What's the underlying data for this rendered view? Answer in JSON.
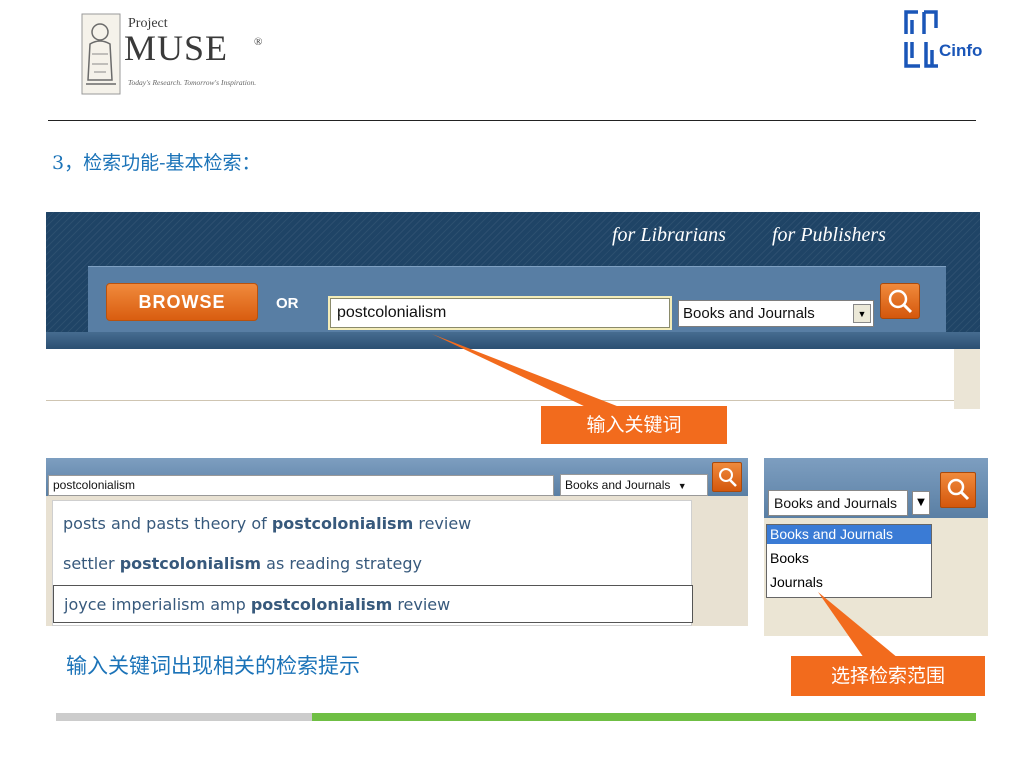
{
  "header": {
    "logo": {
      "project": "Project",
      "muse": "MUSE",
      "registered": "®",
      "tagline": "Today's Research. Tomorrow's Inspiration."
    },
    "cinfo_label": "Cinfo",
    "heading": "3，检索功能-基本检索："
  },
  "banner": {
    "links": [
      "for Librarians",
      "for Publishers"
    ],
    "browse_label": "BROWSE",
    "or_label": "OR",
    "search_value": "postcolonialism",
    "scope_value": "Books and Journals"
  },
  "callouts": {
    "keyword": "输入关键词",
    "scope": "选择检索范围"
  },
  "suggest_panel": {
    "search_value": "postcolonialism",
    "scope_value": "Books and Journals",
    "suggestions": [
      {
        "pre": "posts and pasts theory of ",
        "kw": "postcolonialism",
        "post": " review"
      },
      {
        "pre": "settler ",
        "kw": "postcolonialism",
        "post": " as reading strategy"
      },
      {
        "pre": "joyce imperialism amp ",
        "kw": "postcolonialism",
        "post": " review"
      }
    ]
  },
  "scope_panel": {
    "selected": "Books and Journals",
    "options": [
      "Books and Journals",
      "Books",
      "Journals"
    ]
  },
  "caption": "输入关键词出现相关的检索提示",
  "colors": {
    "navy": "#1f4466",
    "accent_orange": "#f26b1d",
    "heading_blue": "#1b73b8",
    "bar_green": "#6fbf44",
    "bar_grey": "#cccccc"
  }
}
